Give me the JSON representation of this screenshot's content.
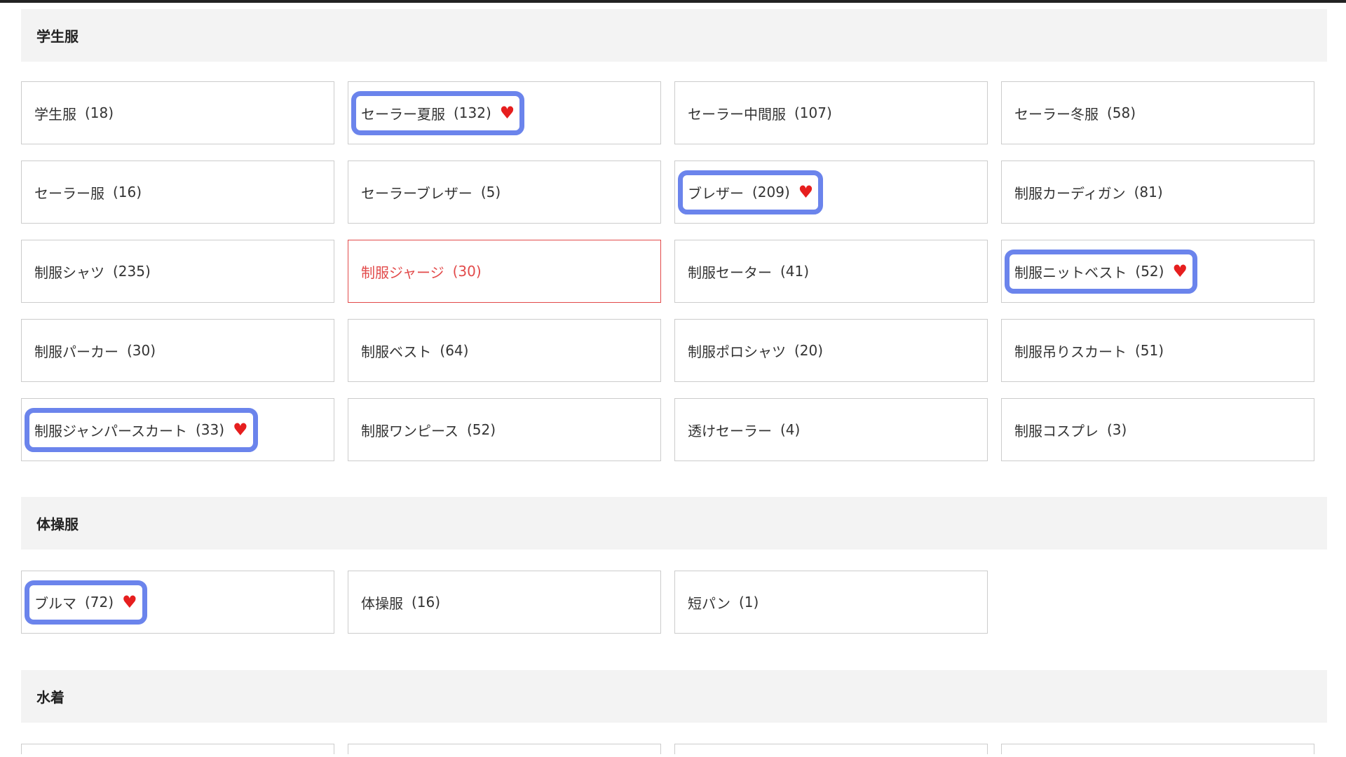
{
  "sections": [
    {
      "title": "学生服",
      "items": [
        {
          "label": "学生服",
          "count": "(18)"
        },
        {
          "label": "セーラー夏服",
          "count": "(132)",
          "favorite": "♥"
        },
        {
          "label": "セーラー中間服",
          "count": "(107)"
        },
        {
          "label": "セーラー冬服",
          "count": "(58)"
        },
        {
          "label": "セーラー服",
          "count": "(16)"
        },
        {
          "label": "セーラーブレザー",
          "count": "(5)"
        },
        {
          "label": "ブレザー",
          "count": "(209)",
          "favorite": "♥"
        },
        {
          "label": "制服カーディガン",
          "count": "(81)"
        },
        {
          "label": "制服シャツ",
          "count": "(235)"
        },
        {
          "label": "制服ジャージ",
          "count": "(30)"
        },
        {
          "label": "制服セーター",
          "count": "(41)"
        },
        {
          "label": "制服ニットベスト",
          "count": "(52)",
          "favorite": "♥"
        },
        {
          "label": "制服パーカー",
          "count": "(30)"
        },
        {
          "label": "制服ベスト",
          "count": "(64)"
        },
        {
          "label": "制服ポロシャツ",
          "count": "(20)"
        },
        {
          "label": "制服吊りスカート",
          "count": "(51)"
        },
        {
          "label": "制服ジャンパースカート",
          "count": "(33)",
          "favorite": "♥"
        },
        {
          "label": "制服ワンピース",
          "count": "(52)"
        },
        {
          "label": "透けセーラー",
          "count": "(4)"
        },
        {
          "label": "制服コスプレ",
          "count": "(3)"
        }
      ]
    },
    {
      "title": "体操服",
      "items": [
        {
          "label": "ブルマ",
          "count": "(72)",
          "favorite": "♥"
        },
        {
          "label": "体操服",
          "count": "(16)"
        },
        {
          "label": "短パン",
          "count": "(1)"
        }
      ]
    },
    {
      "title": "水着",
      "items": []
    }
  ],
  "colors": {
    "active_text": "#e24a4a",
    "highlight_outline": "#6b84ec",
    "heart": "#e61e1e",
    "section_bg": "#f3f3f3"
  }
}
